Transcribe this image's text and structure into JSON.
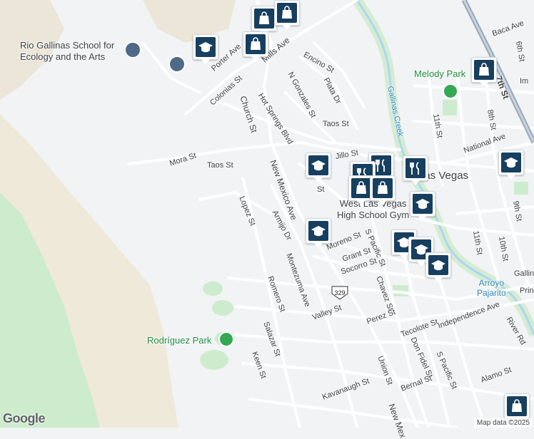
{
  "map": {
    "colors": {
      "background": "#f1f3f4",
      "sand": "#efe9da",
      "green": "#cdeccd",
      "water": "#a9d8f0",
      "road": "#ffffff",
      "highway": "#9aa9bb",
      "marker": "#173f5f"
    },
    "attribution": "Map data ©2025",
    "logo": "Google"
  },
  "places": {
    "school_label": "Rio Gallinas School for\nEcology and the Arts",
    "melody_park": "Melody Park",
    "rodriguez_park": "Rodríguez Park",
    "high_school": "West Las Vegas\nHigh School Gym",
    "las_vegas": "Las Vegas",
    "gallinas_creek": "Gallinas Creek",
    "arroyo": "Arroyo\nPajarito",
    "route_shield": "329"
  },
  "streets": [
    "Mills Ave",
    "Porter Ave",
    "Colonias St",
    "Church St",
    "Hot Springs Blvd",
    "N Gonzales St",
    "Plata Dr",
    "Encino St",
    "Taos St",
    "Taos St",
    "Mora St",
    "New Mexico Ave",
    "Lopez St",
    "Armijo Dr",
    "Montezuma Ave",
    "Romero St",
    "Salazar St",
    "Keen St",
    "Moreno St",
    "Grant St",
    "Socorro St",
    "Chavez St",
    "S Pacific St",
    "Valley St",
    "Perez St",
    "Tecolote St",
    "Don Fidel St",
    "S Pacific St",
    "Union St",
    "Kavanaugh St",
    "Bernal St",
    "Alamo St",
    "Independence Ave",
    "River Rd",
    "National Ave",
    "Baca Ave",
    "6th St",
    "7th St",
    "8th St",
    "11th St",
    "9th St",
    "10th St",
    "11th St",
    "Prin",
    "Gallin",
    "New Mex",
    "Im",
    "Jillo St",
    "St"
  ],
  "markers": [
    {
      "icon": "shopping-bag-icon"
    },
    {
      "icon": "shopping-bag-icon"
    },
    {
      "icon": "graduation-cap-icon"
    },
    {
      "icon": "shopping-bag-icon"
    },
    {
      "icon": "shopping-bag-icon"
    },
    {
      "icon": "graduation-cap-icon"
    },
    {
      "icon": "graduation-cap-icon"
    },
    {
      "icon": "restaurant-icon"
    },
    {
      "icon": "restaurant-icon"
    },
    {
      "icon": "restaurant-icon"
    },
    {
      "icon": "shopping-bag-icon"
    },
    {
      "icon": "shopping-bag-icon"
    },
    {
      "icon": "graduation-cap-icon"
    },
    {
      "icon": "graduation-cap-icon"
    },
    {
      "icon": "graduation-cap-icon"
    },
    {
      "icon": "graduation-cap-icon"
    },
    {
      "icon": "graduation-cap-icon"
    },
    {
      "icon": "shopping-bag-icon"
    }
  ]
}
